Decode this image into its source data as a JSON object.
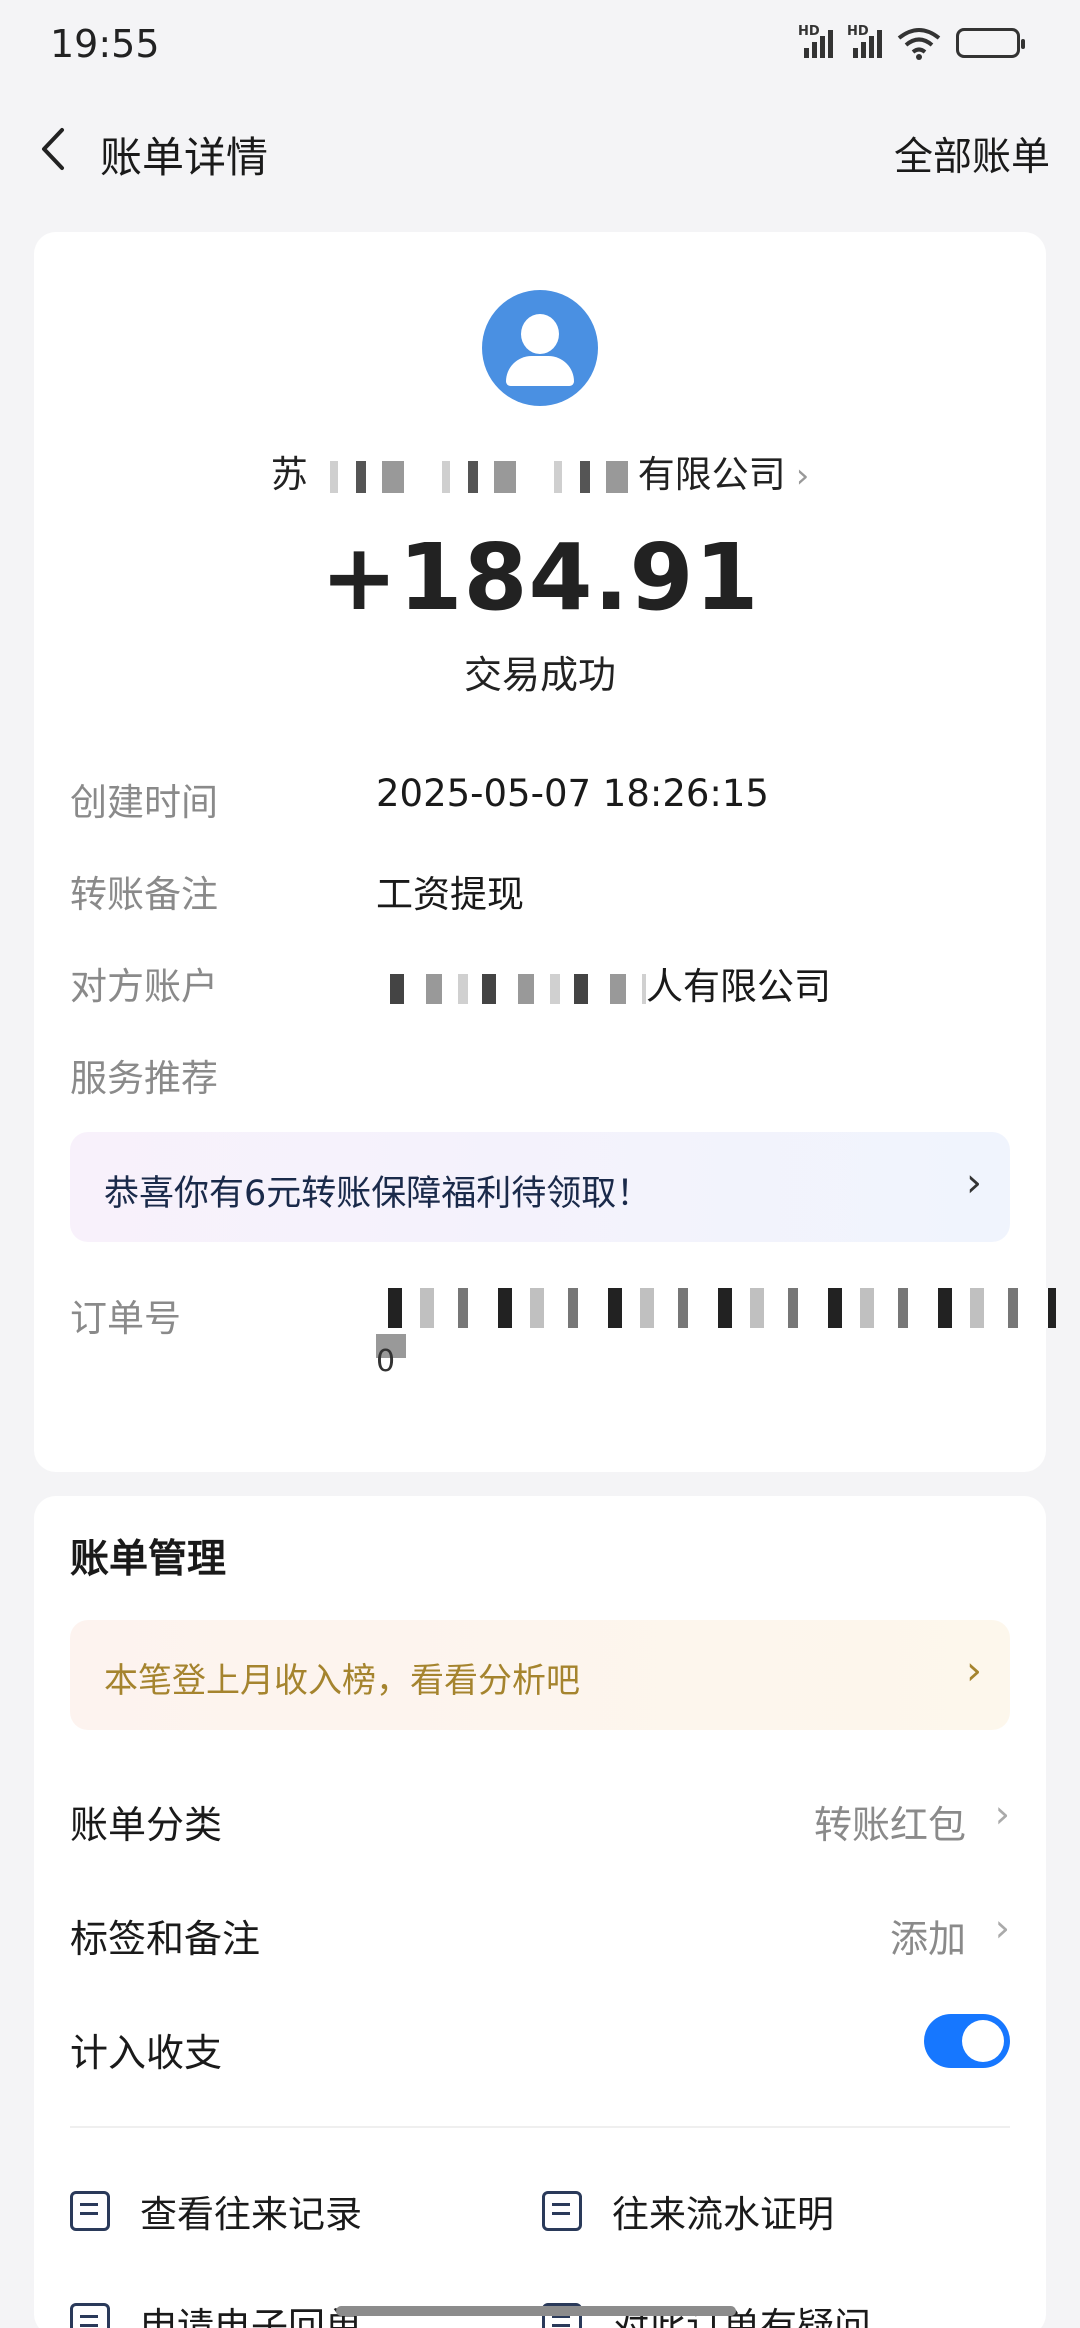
{
  "status_bar": {
    "time": "19:55"
  },
  "nav": {
    "title": "账单详情",
    "right": "全部账单"
  },
  "header": {
    "payee_prefix": "苏",
    "payee_suffix": "有限公司",
    "amount": "+184.91",
    "status": "交易成功"
  },
  "details": {
    "created_label": "创建时间",
    "created_value": "2025-05-07 18:26:15",
    "memo_label": "转账备注",
    "memo_value": "工资提现",
    "counterparty_label": "对方账户",
    "counterparty_suffix": "人有限公司",
    "service_label": "服务推荐",
    "promo": "恭喜你有6元转账保障福利待领取！",
    "order_label": "订单号",
    "order_tail": "0"
  },
  "management": {
    "title": "账单管理",
    "rank_banner": "本笔登上月收入榜，看看分析吧",
    "category_label": "账单分类",
    "category_value": "转账红包",
    "tags_label": "标签和备注",
    "tags_value": "添加",
    "count_label": "计入收支",
    "count_enabled": true,
    "actions": [
      {
        "label": "查看往来记录"
      },
      {
        "label": "往来流水证明"
      },
      {
        "label": "申请电子回单"
      },
      {
        "label": "对此订单有疑问"
      }
    ]
  }
}
